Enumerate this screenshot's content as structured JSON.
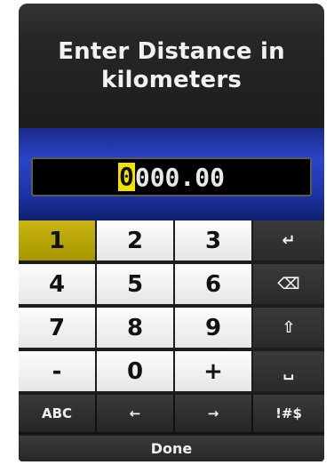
{
  "header": {
    "title": "Enter Distance in kilometers"
  },
  "entry": {
    "cursor_char": "0",
    "rest": "000.00"
  },
  "keypad": {
    "rows": [
      [
        "1",
        "2",
        "3",
        "↵"
      ],
      [
        "4",
        "5",
        "6",
        "⌫"
      ],
      [
        "7",
        "8",
        "9",
        "⇧"
      ],
      [
        "-",
        "0",
        "+",
        "␣"
      ]
    ],
    "bottom": [
      "ABC",
      "←",
      "→",
      "!#$"
    ]
  },
  "done_label": "Done",
  "colors": {
    "selected_key": "#b8a400",
    "entry_band": "#2b45c9",
    "cursor": "#f2e200"
  }
}
